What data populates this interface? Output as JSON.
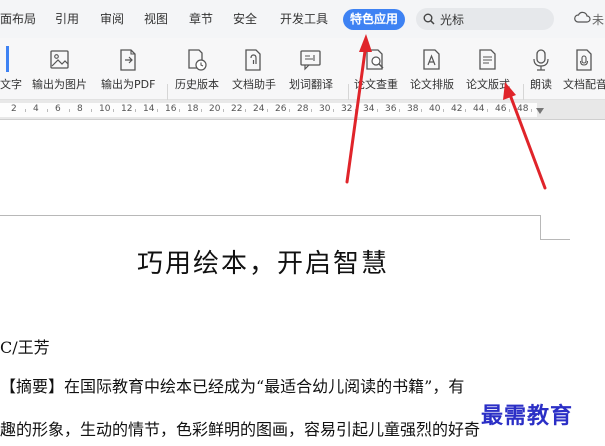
{
  "tabs": [
    {
      "label": "面布局"
    },
    {
      "label": "引用"
    },
    {
      "label": "审阅"
    },
    {
      "label": "视图"
    },
    {
      "label": "章节"
    },
    {
      "label": "安全"
    },
    {
      "label": "开发工具"
    },
    {
      "label": "特色应用",
      "active": true
    }
  ],
  "search": {
    "label": "光标",
    "icon": "search-icon"
  },
  "cloud": {
    "icon": "cloud-icon",
    "label": "未"
  },
  "ribbon": {
    "items": [
      {
        "label": "文字",
        "icon": "image-to-text-icon"
      },
      {
        "label": "输出为图片",
        "icon": "export-image-icon"
      },
      {
        "label": "输出为PDF",
        "icon": "export-pdf-icon"
      },
      {
        "label": "历史版本",
        "icon": "history-version-icon"
      },
      {
        "label": "文档助手",
        "icon": "doc-assistant-icon"
      },
      {
        "label": "划词翻译",
        "icon": "word-translate-icon"
      },
      {
        "label": "论文查重",
        "icon": "paper-check-icon"
      },
      {
        "label": "论文排版",
        "icon": "paper-layout-icon"
      },
      {
        "label": "论文版式",
        "icon": "paper-format-icon"
      },
      {
        "label": "朗读",
        "icon": "read-aloud-icon"
      },
      {
        "label": "文档配音",
        "icon": "doc-dubbing-icon"
      }
    ]
  },
  "ruler": {
    "numbers": [
      "2",
      "4",
      "6",
      "8",
      "10",
      "12",
      "14",
      "16",
      "18",
      "20",
      "22",
      "24",
      "26",
      "28",
      "30",
      "32",
      "34",
      "36",
      "38",
      "40",
      "42",
      "44",
      "46",
      "48"
    ]
  },
  "document": {
    "title": "巧用绘本，开启智慧",
    "author": "C/王芳",
    "paragraph_line1": "【摘要】在国际教育中绘本已经成为“最适合幼儿阅读的书籍”，有",
    "paragraph_line2": "趣的形象，生动的情节，色彩鲜明的图画，容易引起儿童强烈的好奇"
  },
  "watermark": "最需教育",
  "colors": {
    "accent": "#3e82f3",
    "arrow": "#e0242a",
    "watermark": "#2b2fc6"
  }
}
